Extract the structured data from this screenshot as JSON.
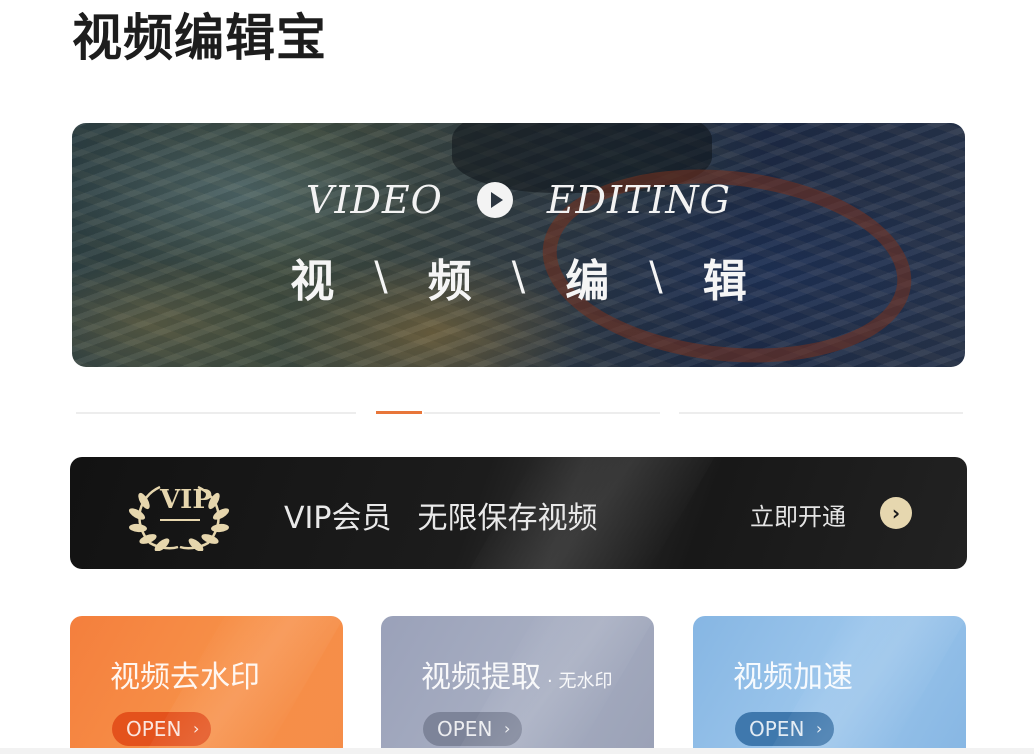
{
  "app": {
    "title": "视频编辑宝"
  },
  "banner": {
    "en_left": "VIDEO",
    "en_right": "EDITING",
    "cn_chars": [
      "视",
      "频",
      "编",
      "辑"
    ],
    "separator": "\\",
    "icon": "play-icon"
  },
  "carousel": {
    "pages": 3,
    "active_index": 1
  },
  "vip": {
    "badge": "VIP",
    "title": "VIP会员",
    "slogan": "无限保存视频",
    "cta": "立即开通",
    "cta_icon": "chevron-right-icon",
    "accent": "#e6d7af"
  },
  "cards": [
    {
      "title": "视频去水印",
      "sub": "",
      "button": "OPEN",
      "color": "#f58d49"
    },
    {
      "title": "视频提取",
      "sub": "· 无水印",
      "button": "OPEN",
      "color": "#a7aec2"
    },
    {
      "title": "视频加速",
      "sub": "",
      "button": "OPEN",
      "color": "#9cc6ec"
    }
  ]
}
